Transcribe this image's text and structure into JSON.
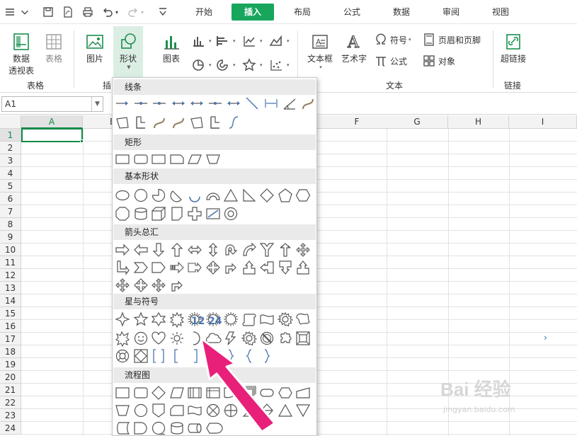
{
  "menubar": {
    "tabs": [
      "开始",
      "插入",
      "布局",
      "公式",
      "数据",
      "审阅",
      "视图"
    ],
    "active_tab": "插入"
  },
  "ribbon": {
    "pivot_label": "数据\n透视表",
    "pivot_line1": "数据",
    "pivot_line2": "透视表",
    "table_label": "表格",
    "picture_label": "图片",
    "shapes_label": "形状",
    "chart_label": "图表",
    "textbox_label": "文本框",
    "wordart_label": "艺术字",
    "symbol_label": "符号",
    "equation_label": "公式",
    "header_footer_label": "页眉和页脚",
    "object_label": "对象",
    "hyperlink_label": "超链接",
    "group_table": "表格",
    "group_illustrations": "插",
    "group_text": "文本",
    "group_links": "链接"
  },
  "formula_bar": {
    "name_box": "A1"
  },
  "grid": {
    "columns": [
      "A",
      "B",
      "F",
      "G",
      "H",
      "I"
    ],
    "rows": [
      "1",
      "2",
      "3",
      "4",
      "5",
      "6",
      "7",
      "8",
      "9",
      "10",
      "11",
      "12",
      "13",
      "14",
      "15",
      "16",
      "17",
      "18",
      "19",
      "20",
      "21",
      "22",
      "23",
      "24"
    ]
  },
  "shapes_menu": {
    "sections": [
      "线条",
      "矩形",
      "基本形状",
      "箭头总汇",
      "星与符号",
      "流程图"
    ],
    "star_labels": [
      "12",
      "24"
    ]
  },
  "watermark": {
    "brand": "Bai 经验",
    "url": "jingyan.baidu.com"
  },
  "colors": {
    "accent": "#18a65d",
    "selection": "#0f8a47",
    "pointer": "#e8207a",
    "shape_stroke": "#555555"
  }
}
